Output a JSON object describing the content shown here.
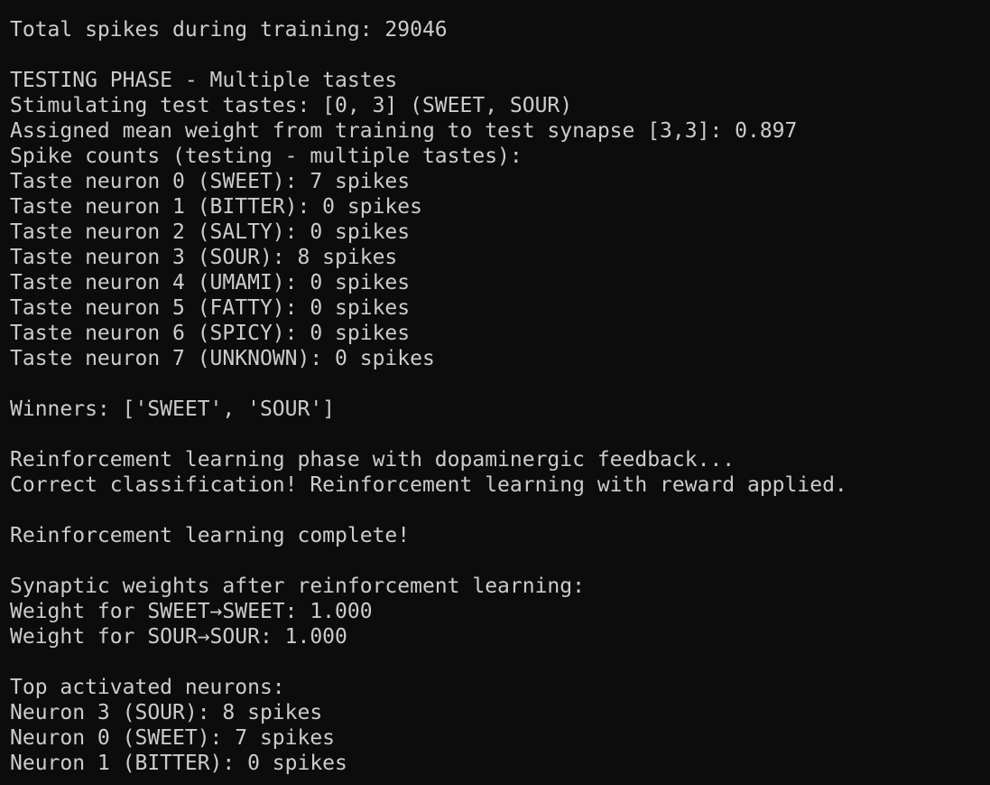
{
  "terminal": {
    "lines": [
      "Total spikes during training: 29046",
      "",
      "TESTING PHASE - Multiple tastes",
      "Stimulating test tastes: [0, 3] (SWEET, SOUR)",
      "Assigned mean weight from training to test synapse [3,3]: 0.897",
      "Spike counts (testing - multiple tastes):",
      "Taste neuron 0 (SWEET): 7 spikes",
      "Taste neuron 1 (BITTER): 0 spikes",
      "Taste neuron 2 (SALTY): 0 spikes",
      "Taste neuron 3 (SOUR): 8 spikes",
      "Taste neuron 4 (UMAMI): 0 spikes",
      "Taste neuron 5 (FATTY): 0 spikes",
      "Taste neuron 6 (SPICY): 0 spikes",
      "Taste neuron 7 (UNKNOWN): 0 spikes",
      "",
      "Winners: ['SWEET', 'SOUR']",
      "",
      "Reinforcement learning phase with dopaminergic feedback...",
      "Correct classification! Reinforcement learning with reward applied.",
      "",
      "Reinforcement learning complete!",
      "",
      "Synaptic weights after reinforcement learning:",
      "Weight for SWEET→SWEET: 1.000",
      "Weight for SOUR→SOUR: 1.000",
      "",
      "Top activated neurons:",
      "Neuron 3 (SOUR): 8 spikes",
      "Neuron 0 (SWEET): 7 spikes",
      "Neuron 1 (BITTER): 0 spikes"
    ]
  },
  "colors": {
    "background": "#0c0c0c",
    "text": "#cccccc"
  }
}
